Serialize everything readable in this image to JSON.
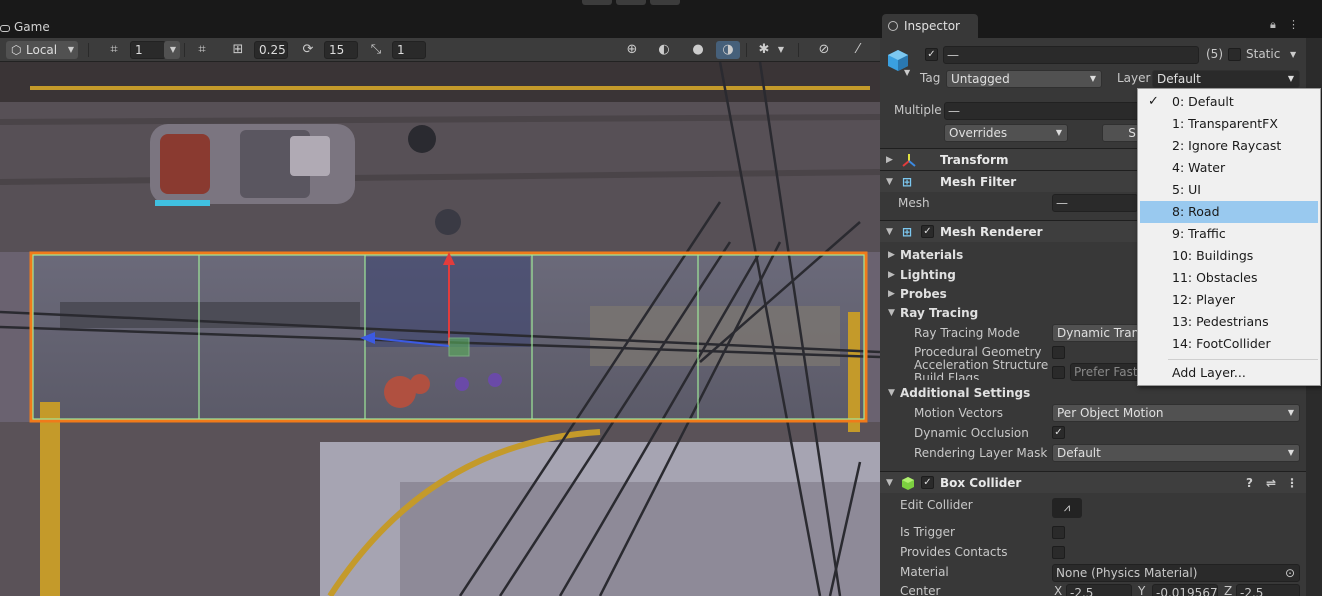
{
  "game_tab": {
    "label": "Game"
  },
  "scene_toolbar": {
    "pivot_mode": "Local",
    "grid_value": "1",
    "snap_increment": "0.25",
    "rotation_snap": "15",
    "scale_snap": "1"
  },
  "inspector": {
    "tab_label": "Inspector",
    "object_name": "—",
    "object_count": "(5)",
    "static_label": "Static",
    "tag_label": "Tag",
    "tag_value": "Untagged",
    "layer_label": "Layer",
    "layer_value": "Default",
    "multiple_label": "Multiple",
    "multiple_value": "—",
    "overrides_label": "Overrides",
    "select_label": "S",
    "transform_label": "Transform",
    "mesh_filter_label": "Mesh Filter",
    "mesh_label": "Mesh",
    "mesh_value": "—",
    "mesh_renderer_label": "Mesh Renderer",
    "materials_label": "Materials",
    "lighting_label": "Lighting",
    "probes_label": "Probes",
    "ray_tracing_label": "Ray Tracing",
    "ray_tracing_mode_label": "Ray Tracing Mode",
    "ray_tracing_mode_value": "Dynamic Trans",
    "procedural_label_1": "Procedural Geometry",
    "accel_label_1": "Acceleration Structure",
    "accel_label_2": "Build Flags",
    "prefer_fast_label": "Prefer Fast",
    "additional_settings_label": "Additional Settings",
    "motion_vectors_label": "Motion Vectors",
    "motion_vectors_value": "Per Object Motion",
    "dynamic_occlusion_label": "Dynamic Occlusion",
    "rendering_layer_mask_label": "Rendering Layer Mask",
    "rendering_layer_mask_value": "Default",
    "box_collider_label": "Box Collider",
    "edit_collider_label": "Edit Collider",
    "is_trigger_label": "Is Trigger",
    "provides_contacts_label": "Provides Contacts",
    "material_label": "Material",
    "material_value": "None (Physics Material)",
    "center_label": "Center",
    "center_x_label": "X",
    "center_x_value": "-2.5",
    "center_y_label": "Y",
    "center_y_value": "-0.019567",
    "center_z_label": "Z",
    "center_z_value": "-2.5"
  },
  "layer_menu": {
    "items": [
      {
        "label": "0: Default",
        "checked": true
      },
      {
        "label": "1: TransparentFX"
      },
      {
        "label": "2: Ignore Raycast"
      },
      {
        "label": "4: Water"
      },
      {
        "label": "5: UI"
      },
      {
        "label": "8: Road",
        "highlighted": true
      },
      {
        "label": "9: Traffic"
      },
      {
        "label": "10: Buildings"
      },
      {
        "label": "11: Obstacles"
      },
      {
        "label": "12: Player"
      },
      {
        "label": "13: Pedestrians"
      },
      {
        "label": "14: FootCollider"
      }
    ],
    "add_layer": "Add Layer..."
  },
  "colors": {
    "selection_outline": "#f07a1a",
    "collider_lines": "#9fe89a",
    "menu_highlight": "#99c9ef",
    "y_axis": "#e23c3c",
    "x_axis": "#3c5ae2"
  }
}
